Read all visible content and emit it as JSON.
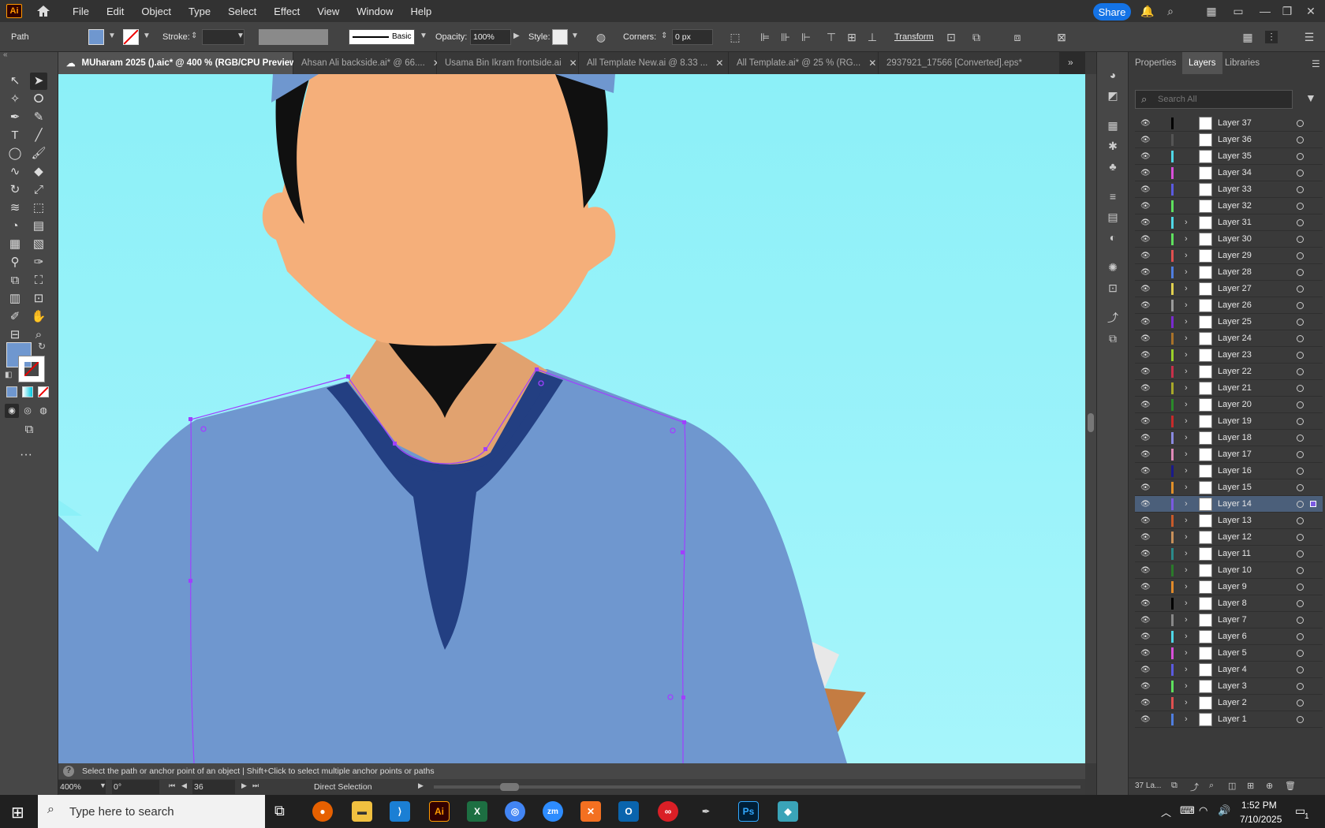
{
  "menu": {
    "items": [
      "File",
      "Edit",
      "Object",
      "Type",
      "Select",
      "Effect",
      "View",
      "Window",
      "Help"
    ],
    "share": "Share",
    "app_badge": "Ai"
  },
  "control": {
    "selection": "Path",
    "stroke_label": "Stroke:",
    "stroke_style": "Basic",
    "opacity_label": "Opacity:",
    "opacity_value": "100%",
    "style_label": "Style:",
    "corners_label": "Corners:",
    "corners_value": "0 px",
    "transform": "Transform"
  },
  "tabs": [
    {
      "label": "MUharam 2025 ().aic* @ 400 % (RGB/CPU Preview)"
    },
    {
      "label": "Ahsan Ali backside.ai* @ 66...."
    },
    {
      "label": "Usama Bin Ikram frontside.ai"
    },
    {
      "label": "All Template New.ai @ 8.33 ..."
    },
    {
      "label": "All Template.ai* @ 25 % (RG..."
    },
    {
      "label": "2937921_17566 [Converted].eps*"
    }
  ],
  "hint": {
    "text": "Select the path or anchor point of an object  |  Shift+Click to select multiple anchor points or paths"
  },
  "status": {
    "zoom": "400%",
    "angle": "0°",
    "artboard": "36",
    "tool": "Direct Selection"
  },
  "panel": {
    "tabs": [
      "Properties",
      "Layers",
      "Libraries"
    ],
    "search_placeholder": "Search All",
    "layer_count": "37 La..."
  },
  "layers": [
    {
      "name": "Layer 37",
      "color": "#000000",
      "expand": false
    },
    {
      "name": "Layer 36",
      "color": "#555555",
      "expand": false
    },
    {
      "name": "Layer 35",
      "color": "#4fd7e6",
      "expand": false
    },
    {
      "name": "Layer 34",
      "color": "#d94fd9",
      "expand": false
    },
    {
      "name": "Layer 33",
      "color": "#5a5ae0",
      "expand": false
    },
    {
      "name": "Layer 32",
      "color": "#5ee05e",
      "expand": false
    },
    {
      "name": "Layer 31",
      "color": "#4fd7e6",
      "expand": true
    },
    {
      "name": "Layer 30",
      "color": "#5ee05e",
      "expand": true
    },
    {
      "name": "Layer 29",
      "color": "#e05050",
      "expand": true
    },
    {
      "name": "Layer 28",
      "color": "#4f7ee0",
      "expand": true
    },
    {
      "name": "Layer 27",
      "color": "#e0d050",
      "expand": true
    },
    {
      "name": "Layer 26",
      "color": "#9a9a9a",
      "expand": true
    },
    {
      "name": "Layer 25",
      "color": "#7a2ad0",
      "expand": true
    },
    {
      "name": "Layer 24",
      "color": "#a8722a",
      "expand": true
    },
    {
      "name": "Layer 23",
      "color": "#9ad02a",
      "expand": true
    },
    {
      "name": "Layer 22",
      "color": "#c8304a",
      "expand": true
    },
    {
      "name": "Layer 21",
      "color": "#a8a82a",
      "expand": true
    },
    {
      "name": "Layer 20",
      "color": "#2a8a2a",
      "expand": true
    },
    {
      "name": "Layer 19",
      "color": "#c82a2a",
      "expand": true
    },
    {
      "name": "Layer 18",
      "color": "#8a8ae0",
      "expand": true
    },
    {
      "name": "Layer 17",
      "color": "#e08ab8",
      "expand": true
    },
    {
      "name": "Layer 16",
      "color": "#1a1a8a",
      "expand": true
    },
    {
      "name": "Layer 15",
      "color": "#e0902a",
      "expand": true
    },
    {
      "name": "Layer 14",
      "color": "#7a5ae0",
      "expand": true,
      "selected": true
    },
    {
      "name": "Layer 13",
      "color": "#c85a2a",
      "expand": true
    },
    {
      "name": "Layer 12",
      "color": "#c8905a",
      "expand": true
    },
    {
      "name": "Layer 11",
      "color": "#2a8a8a",
      "expand": true
    },
    {
      "name": "Layer 10",
      "color": "#2a7a2a",
      "expand": true
    },
    {
      "name": "Layer 9",
      "color": "#e08a2a",
      "expand": true
    },
    {
      "name": "Layer 8",
      "color": "#000000",
      "expand": true
    },
    {
      "name": "Layer 7",
      "color": "#888888",
      "expand": true
    },
    {
      "name": "Layer 6",
      "color": "#4fd7e6",
      "expand": true
    },
    {
      "name": "Layer 5",
      "color": "#d94fd9",
      "expand": true
    },
    {
      "name": "Layer 4",
      "color": "#5a5ae0",
      "expand": true
    },
    {
      "name": "Layer 3",
      "color": "#5ee05e",
      "expand": true
    },
    {
      "name": "Layer 2",
      "color": "#e05050",
      "expand": true
    },
    {
      "name": "Layer 1",
      "color": "#4f7ee0",
      "expand": true
    }
  ],
  "taskbar": {
    "search_placeholder": "Type here to search",
    "time": "1:52 PM",
    "date": "7/10/2025",
    "notifications": "1"
  }
}
